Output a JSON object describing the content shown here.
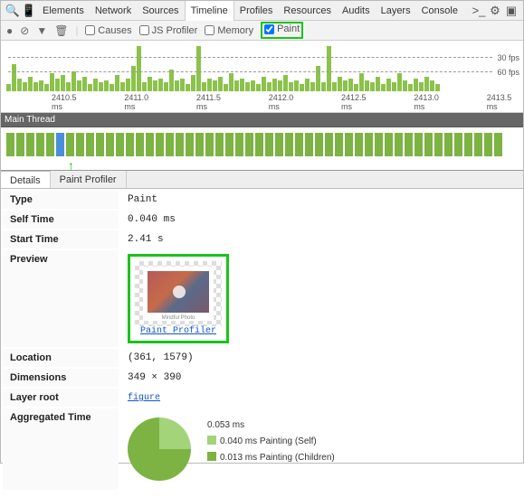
{
  "tabs": {
    "items": [
      "Elements",
      "Network",
      "Sources",
      "Timeline",
      "Profiles",
      "Resources",
      "Audits",
      "Layers",
      "Console"
    ],
    "selected": "Timeline"
  },
  "toolbar": {
    "causes": "Causes",
    "jsprofiler": "JS Profiler",
    "memory": "Memory",
    "paint": "Paint"
  },
  "overview": {
    "fps30": "30 fps",
    "fps60": "60 fps",
    "ticks": [
      "2410.5 ms",
      "2411.0 ms",
      "2411.5 ms",
      "2412.0 ms",
      "2412.5 ms",
      "2413.0 ms",
      "2413.5 ms"
    ]
  },
  "mainthread": "Main Thread",
  "subtabs": {
    "items": [
      "Details",
      "Paint Profiler"
    ],
    "selected": "Details"
  },
  "details": {
    "type_k": "Type",
    "type_v": "Paint",
    "self_k": "Self Time",
    "self_v": "0.040 ms",
    "start_k": "Start Time",
    "start_v": "2.41 s",
    "preview_k": "Preview",
    "preview_caption": "Mindful Photo",
    "preview_link": "Paint Profiler",
    "loc_k": "Location",
    "loc_v": "(361, 1579)",
    "dim_k": "Dimensions",
    "dim_v": "349 × 390",
    "layer_k": "Layer root",
    "layer_v": "figure",
    "agg_k": "Aggregated Time",
    "agg_total": "0.053 ms",
    "agg_self": "0.040 ms Painting (Self)",
    "agg_child": "0.013 ms Painting (Children)"
  },
  "chart_data": {
    "type": "pie",
    "title": "Aggregated Time",
    "series": [
      {
        "name": "Painting (Self)",
        "value_ms": 0.04
      },
      {
        "name": "Painting (Children)",
        "value_ms": 0.013
      }
    ],
    "total_ms": 0.053
  }
}
